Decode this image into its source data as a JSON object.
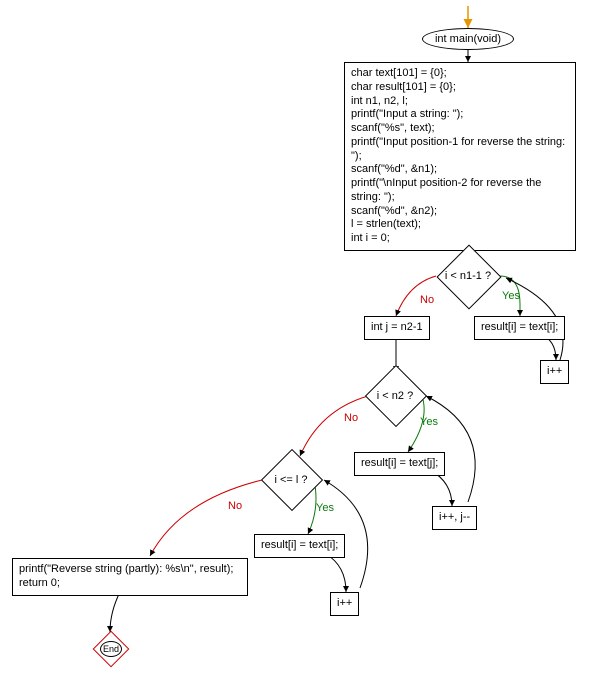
{
  "flowchart": {
    "type": "code-flowchart",
    "language": "C",
    "start": {
      "label": "int main(void)"
    },
    "init_block": {
      "lines": [
        "char text[101] = {0};",
        "char result[101] = {0};",
        "int n1, n2, l;",
        "printf(\"Input a string: \");",
        "scanf(\"%s\", text);",
        "printf(\"Input position-1 for reverse the string: \");",
        "scanf(\"%d\", &n1);",
        "printf(\"\\nInput position-2 for reverse the string: \");",
        "scanf(\"%d\", &n2);",
        "l = strlen(text);",
        "int i = 0;"
      ]
    },
    "cond1": {
      "label": "i < n1-1 ?",
      "yes": "Yes",
      "no": "No"
    },
    "body1": {
      "label": "result[i] = text[i];"
    },
    "step1": {
      "label": "i++"
    },
    "after1": {
      "label": "int j = n2-1"
    },
    "cond2": {
      "label": "i < n2 ?",
      "yes": "Yes",
      "no": "No"
    },
    "body2": {
      "label": "result[i] = text[j];"
    },
    "step2": {
      "label": "i++, j--"
    },
    "cond3": {
      "label": "i <= l ?",
      "yes": "Yes",
      "no": "No"
    },
    "body3": {
      "label": "result[i] = text[i];"
    },
    "step3": {
      "label": "i++"
    },
    "final": {
      "lines": [
        "printf(\"Reverse string (partly): %s\\n\", result);",
        "return 0;"
      ]
    },
    "end": {
      "label": "End"
    }
  }
}
